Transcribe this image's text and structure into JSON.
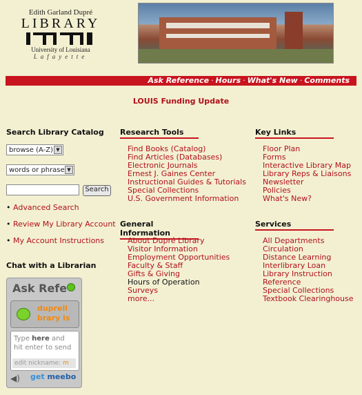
{
  "logo": {
    "top": "Edith Garland Dupré",
    "library": "LIBRARY",
    "university": "University of Louisiana",
    "city": "Lafayette"
  },
  "nav": {
    "links": [
      "Ask Reference",
      "Hours",
      "What's New",
      "Comments"
    ],
    "separator": "·"
  },
  "funding": "LOUIS Funding Update",
  "search": {
    "heading": "Search Library Catalog",
    "browse_select": "browse (A-Z)",
    "words_select": "words or phrase",
    "input_value": "",
    "button": "Search",
    "links": [
      "Advanced Search",
      "Review My Library Account",
      "My Account Instructions"
    ]
  },
  "chat": {
    "heading": "Chat with a Librarian",
    "widget_title": "Ask Reference",
    "username_line1": "dupreli",
    "username_line2": "brary is",
    "msg_pre": "Type ",
    "msg_bold": "here",
    "msg_post": " and",
    "msg_line2": "hit enter to send",
    "nickname_label": "edit nickname:",
    "nickname_value": "m",
    "brand_get": "get",
    "brand_meebo": "meebo"
  },
  "research": {
    "heading": "Research Tools",
    "items": [
      "Find Books (Catalog)",
      "Find Articles (Databases)",
      "Electronic Journals",
      "Ernest J. Gaines Center",
      "Instructional Guides & Tutorials",
      "Special Collections",
      "U.S. Government Information"
    ]
  },
  "keylinks": {
    "heading": "Key Links",
    "items": [
      "Floor Plan",
      "Forms",
      "Interactive Library Map",
      "Library Reps & Liaisons",
      "Newsletter",
      "Policies",
      "What's New?"
    ]
  },
  "general": {
    "heading": "General Information",
    "items": [
      "About Dupré Library",
      "Visitor Information",
      "Employment Opportunities",
      "Faculty & Staff",
      "Gifts & Giving",
      "Hours of Operation",
      "Surveys",
      "more..."
    ]
  },
  "services": {
    "heading": "Services",
    "items": [
      "All Departments",
      "Circulation",
      "Distance Learning",
      "Interlibrary Loan",
      "Library Instruction",
      "Reference",
      "Special Collections",
      "Textbook Clearinghouse"
    ]
  },
  "colors": {
    "accent_red": "#c8141e",
    "link_red": "#b0101a",
    "background": "#f3f0d2"
  }
}
